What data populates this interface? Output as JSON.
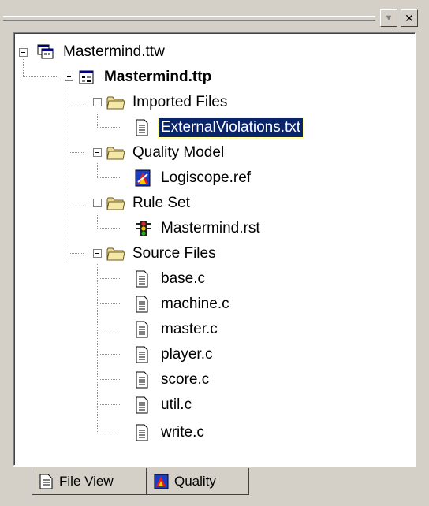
{
  "window": {
    "dropdown_glyph": "▼",
    "close_glyph": "✕"
  },
  "tree": {
    "root": {
      "label": "Mastermind.ttw",
      "icon": "workspace-icon"
    },
    "project": {
      "label": "Mastermind.ttp",
      "icon": "project-icon"
    },
    "folders": [
      {
        "label": "Imported Files",
        "icon": "folder-icon",
        "children": [
          {
            "label": "ExternalViolations.txt",
            "icon": "text-file-icon",
            "selected": true
          }
        ]
      },
      {
        "label": "Quality Model",
        "icon": "folder-icon",
        "children": [
          {
            "label": "Logiscope.ref",
            "icon": "quality-model-icon"
          }
        ]
      },
      {
        "label": "Rule Set",
        "icon": "folder-icon",
        "children": [
          {
            "label": "Mastermind.rst",
            "icon": "traffic-light-icon"
          }
        ]
      },
      {
        "label": "Source Files",
        "icon": "folder-icon",
        "children": [
          {
            "label": "base.c",
            "icon": "text-file-icon"
          },
          {
            "label": "machine.c",
            "icon": "text-file-icon"
          },
          {
            "label": "master.c",
            "icon": "text-file-icon"
          },
          {
            "label": "player.c",
            "icon": "text-file-icon"
          },
          {
            "label": "score.c",
            "icon": "text-file-icon"
          },
          {
            "label": "util.c",
            "icon": "text-file-icon"
          },
          {
            "label": "write.c",
            "icon": "text-file-icon"
          }
        ]
      }
    ]
  },
  "tabs": [
    {
      "label": "File View",
      "icon": "file-view-icon",
      "active": true
    },
    {
      "label": "Quality",
      "icon": "quality-icon",
      "active": false
    }
  ],
  "colors": {
    "selection": "#0a246a",
    "folder": "#e8d890",
    "panel": "#d4d0c8"
  }
}
